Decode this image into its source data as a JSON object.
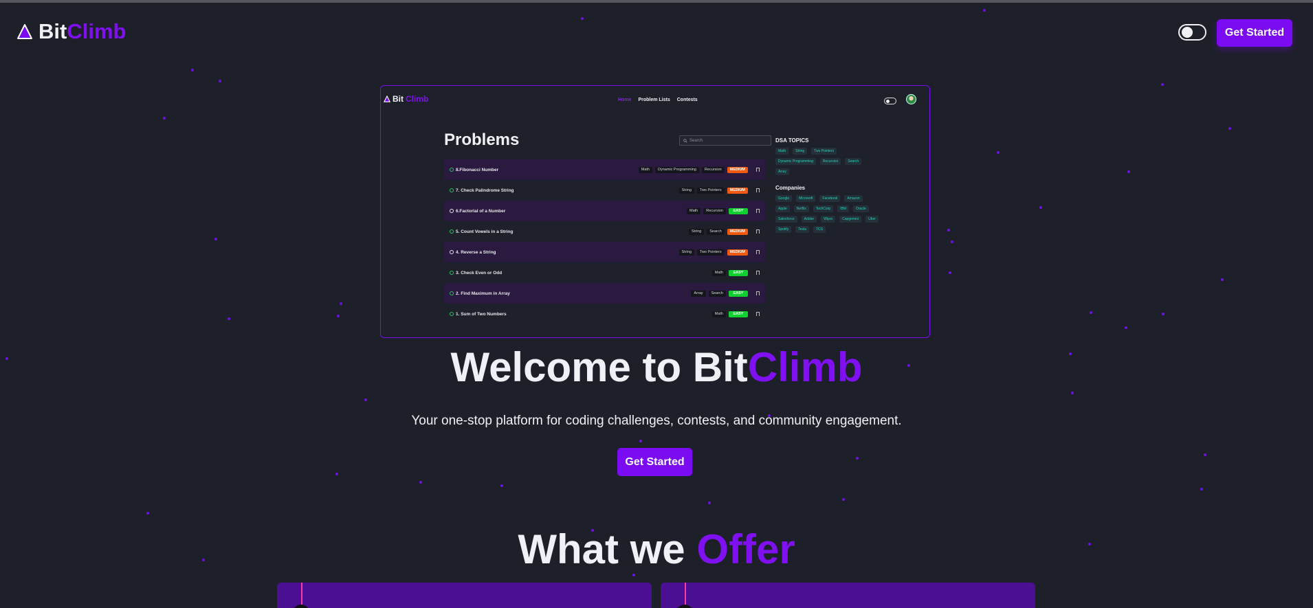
{
  "brand": {
    "prefix": "Bit",
    "suffix": "Climb"
  },
  "header": {
    "cta_label": "Get Started",
    "theme_toggle": "gear-icon"
  },
  "preview": {
    "brand": {
      "prefix": "Bit",
      "suffix": "Climb"
    },
    "nav": [
      "Home",
      "Problem Lists",
      "Contests"
    ],
    "title": "Problems",
    "search_placeholder": "Search",
    "problems": [
      {
        "title": "8.Fibonacci Number",
        "tags": [
          "Math",
          "Dynamic Programming",
          "Recursion"
        ],
        "difficulty": "MEDIUM",
        "solved": true
      },
      {
        "title": "7. Check Palindrome String",
        "tags": [
          "String",
          "Two Pointers"
        ],
        "difficulty": "MEDIUM",
        "solved": true
      },
      {
        "title": "6.Factorial of a Number",
        "tags": [
          "Math",
          "Recursion"
        ],
        "difficulty": "EASY",
        "solved": false
      },
      {
        "title": "5. Count Vowels in a String",
        "tags": [
          "String",
          "Search"
        ],
        "difficulty": "MEDIUM",
        "solved": true
      },
      {
        "title": "4. Reverse a String",
        "tags": [
          "String",
          "Two Pointers"
        ],
        "difficulty": "MEDIUM",
        "solved": false
      },
      {
        "title": "3. Check Even or Odd",
        "tags": [
          "Math"
        ],
        "difficulty": "EASY",
        "solved": true
      },
      {
        "title": "2. Find Maximum in Array",
        "tags": [
          "Array",
          "Search"
        ],
        "difficulty": "EASY",
        "solved": true
      },
      {
        "title": "1. Sum of Two Numbers",
        "tags": [
          "Math"
        ],
        "difficulty": "EASY",
        "solved": true
      }
    ],
    "topics_heading": "DSA TOPICS",
    "topics": [
      "Math",
      "String",
      "Two Pointers",
      "Dynamic Programming",
      "Recursion",
      "Search",
      "Array"
    ],
    "companies_heading": "Companies",
    "companies": [
      "Google",
      "Microsoft",
      "Facebook",
      "Amazon",
      "Apple",
      "Netflix",
      "TechCorp",
      "IBM",
      "Oracle",
      "Salesforce",
      "Adobe",
      "Wipro",
      "Capgemini",
      "Uber",
      "Spotify",
      "Tesla",
      "TCS"
    ]
  },
  "hero": {
    "title_prefix": "Welcome to Bit",
    "title_accent": "Climb",
    "subtitle": "Your one-stop platform for coding challenges, contests, and community engagement.",
    "cta_label": "Get Started"
  },
  "offer": {
    "title_prefix": "What we ",
    "title_accent": "Offer"
  },
  "colors": {
    "background": "#1e2029",
    "accent": "#7a0bf2",
    "medium": "#f05a10",
    "easy": "#10d030",
    "chip_text": "#1ed7b8"
  }
}
